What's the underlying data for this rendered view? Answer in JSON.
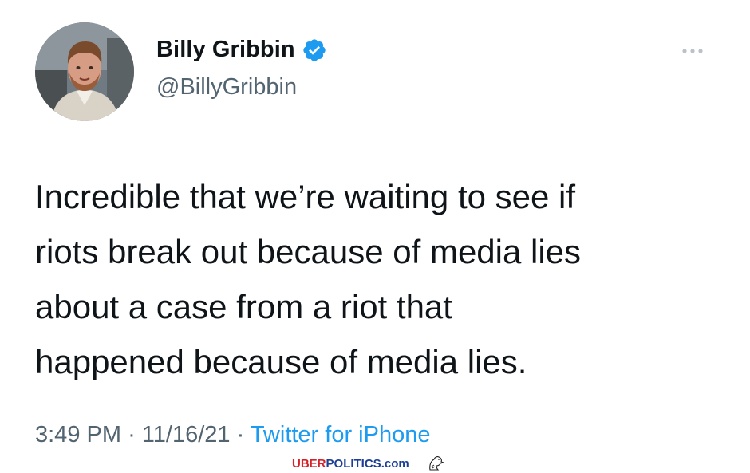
{
  "tweet": {
    "author": {
      "display_name": "Billy Gribbin",
      "handle": "@BillyGribbin",
      "verified": true,
      "avatar_icon": "profile-photo"
    },
    "text_lines": [
      "Incredible that we’re waiting to see if",
      "riots break out because of media lies",
      "about a case from a riot that",
      "happened because of media lies."
    ],
    "time": "3:49 PM",
    "date": "11/16/21",
    "separator": "·",
    "source": "Twitter for iPhone",
    "more_icon": "more-horizontal-icon"
  },
  "watermark": {
    "brand_red": "UBER",
    "brand_blue": "POLITICS",
    "suffix": ".com",
    "icon": "eagle-icon"
  },
  "colors": {
    "text_primary": "#0f1419",
    "text_secondary": "#536471",
    "accent_blue": "#1d9bf0",
    "brand_red": "#d62128",
    "brand_blue": "#1c3f94"
  }
}
